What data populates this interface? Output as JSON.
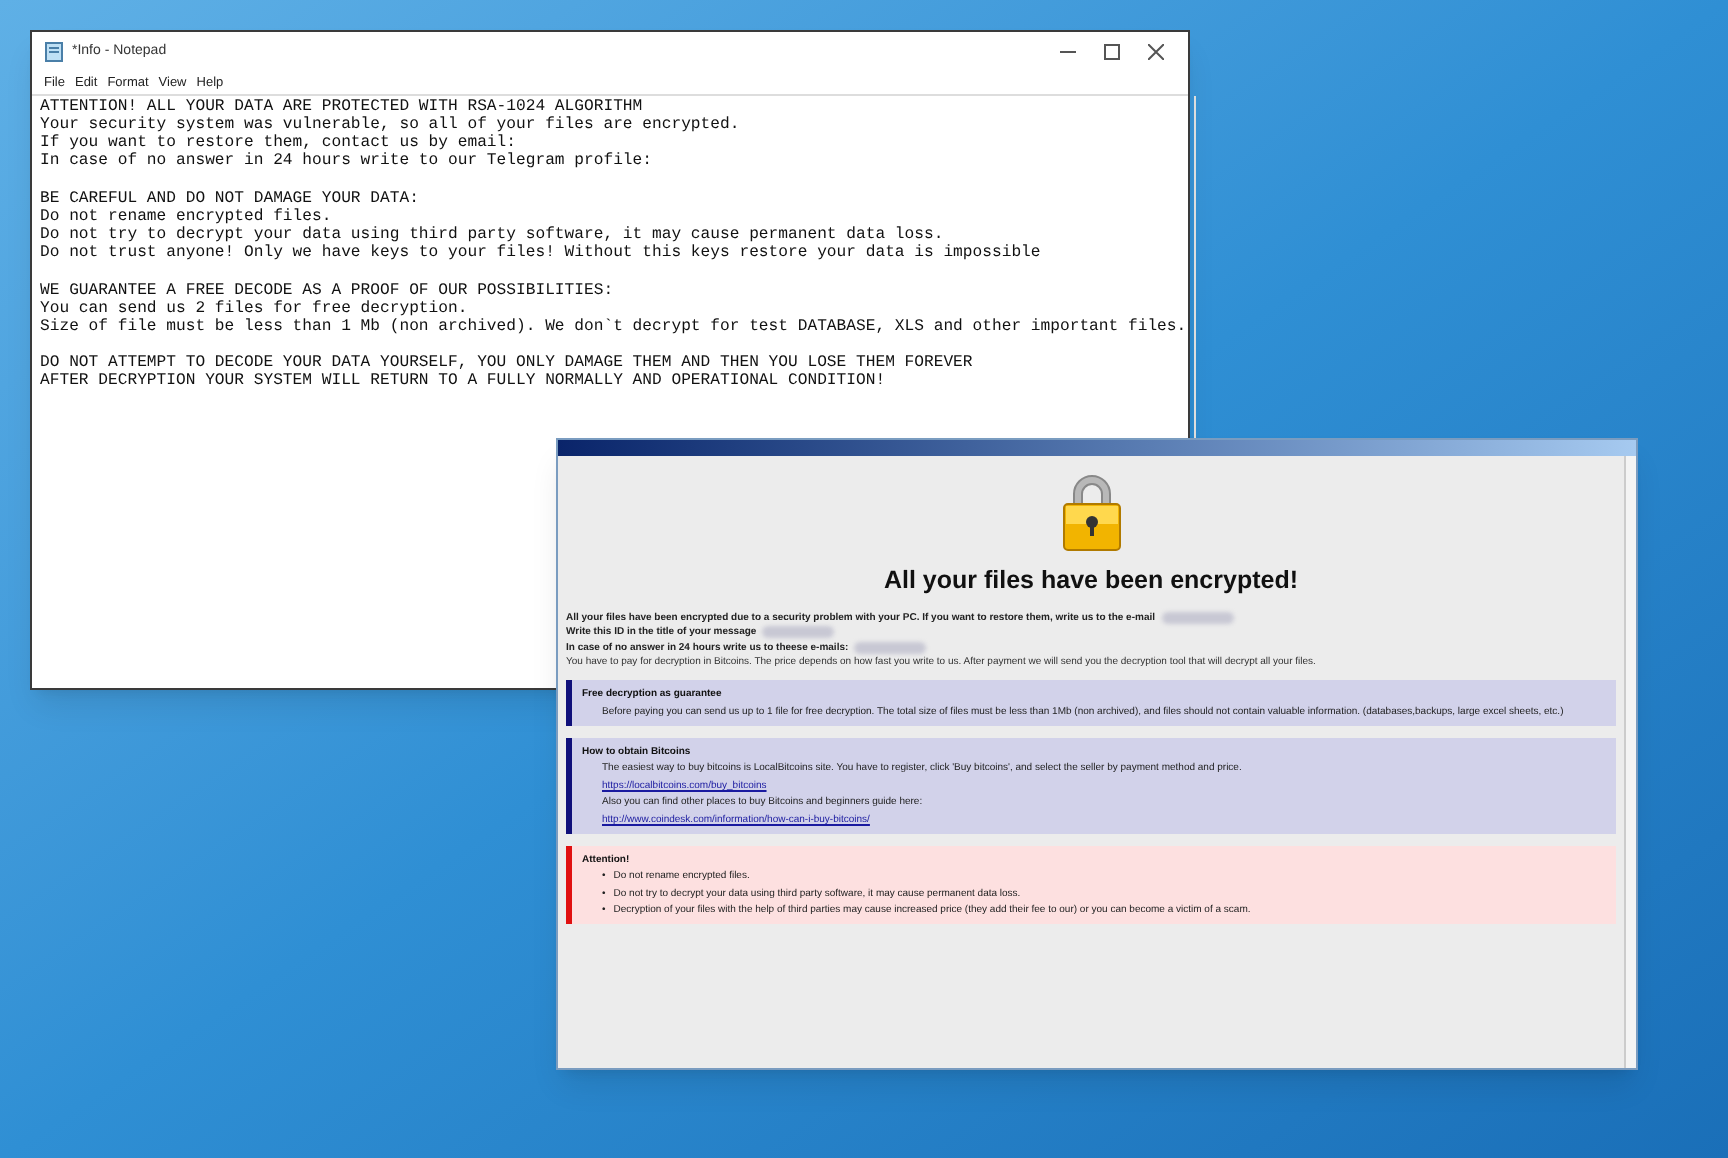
{
  "notepad": {
    "title": "*Info - Notepad",
    "menu": [
      "File",
      "Edit",
      "Format",
      "View",
      "Help"
    ],
    "paragraphs": [
      [
        "ATTENTION! ALL YOUR DATA ARE PROTECTED WITH RSA-1024 ALGORITHM",
        "Your security system was vulnerable, so all of your files are encrypted.",
        "If you want to restore them, contact us by email:",
        "In case of no answer in 24 hours write to our Telegram profile:"
      ],
      [
        "BE CAREFUL AND DO NOT DAMAGE YOUR DATA:",
        "Do not rename encrypted files.",
        "Do not try to decrypt your data using third party software, it may cause permanent data loss.",
        "Do not trust anyone! Only we have keys to your files! Without this keys restore your data is impossible"
      ],
      [
        "WE GUARANTEE A FREE DECODE AS A PROOF OF OUR POSSIBILITIES:",
        "You can send us 2 files for free decryption.",
        "Size of file must be less than 1 Mb (non archived). We don`t decrypt for test DATABASE, XLS and other important files."
      ],
      [
        "DO NOT ATTEMPT TO DECODE YOUR DATA YOURSELF, YOU ONLY DAMAGE THEM AND THEN YOU LOSE THEM FOREVER",
        "AFTER DECRYPTION YOUR SYSTEM WILL RETURN TO A FULLY NORMALLY AND OPERATIONAL CONDITION!"
      ]
    ]
  },
  "ransom_window": {
    "heading": "All your files have been encrypted!",
    "intro": [
      {
        "text": "All your files have been encrypted due to a security problem with your PC. If you want to restore them, write us to the e-mail",
        "bold": true,
        "redacted": true
      },
      {
        "text": "Write this ID in the title of your message",
        "bold": true,
        "redacted": true
      },
      {
        "text": "In case of no answer in 24 hours write us to theese e-mails:",
        "bold": true,
        "redacted": true
      },
      {
        "text": "You have to pay for decryption in Bitcoins. The price depends on how fast you write to us. After payment we will send you the decryption tool that will decrypt all your files.",
        "bold": false,
        "redacted": false
      }
    ],
    "sections": [
      {
        "kind": "info",
        "title": "Free decryption as guarantee",
        "lines": [
          {
            "kind": "text",
            "text": "Before paying you can send us up to 1 file for free decryption. The total size of files must be less than 1Mb (non archived), and files should not contain valuable information. (databases,backups, large excel sheets, etc.)"
          }
        ]
      },
      {
        "kind": "info",
        "title": "How to obtain Bitcoins",
        "lines": [
          {
            "kind": "text",
            "text": "The easiest way to buy bitcoins is LocalBitcoins site. You have to register, click 'Buy bitcoins', and select the seller by payment method and price."
          },
          {
            "kind": "link",
            "text": "https://localbitcoins.com/buy_bitcoins"
          },
          {
            "kind": "text",
            "text": "Also you can find other places to buy Bitcoins and beginners guide here:"
          },
          {
            "kind": "link",
            "text": "http://www.coindesk.com/information/how-can-i-buy-bitcoins/"
          }
        ]
      },
      {
        "kind": "warning",
        "title": "Attention!",
        "lines": [
          {
            "kind": "bullet",
            "marker": "•",
            "text": "Do not rename encrypted files."
          },
          {
            "kind": "bullet",
            "marker": "•",
            "text": "Do not try to decrypt your data using third party software, it may cause permanent data loss."
          },
          {
            "kind": "bullet",
            "marker": "•",
            "text": "Decryption of your files with the help of third parties may cause increased price (they add their fee to our) or you can become a victim of a scam."
          }
        ]
      }
    ]
  }
}
